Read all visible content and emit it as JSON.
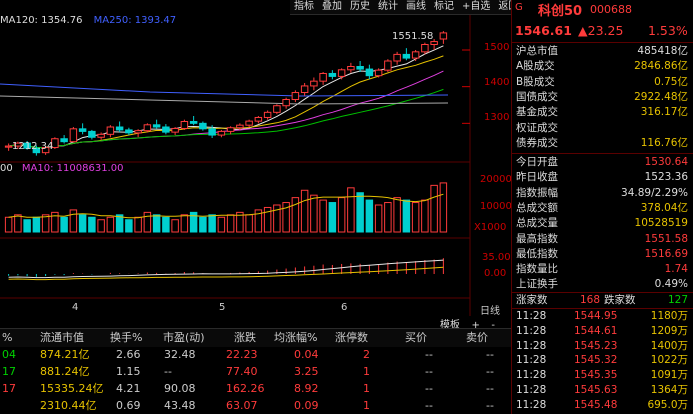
{
  "toolbar": [
    "指标",
    "叠加",
    "历史",
    "统计",
    "画线",
    "标记",
    "+自选",
    "返回"
  ],
  "ma_legend": {
    "ma120": "MA120: 1354.76",
    "ma250": "MA250: 1393.47"
  },
  "vol_legend": {
    "a": "00",
    "ma10": "MA10: 11008631.00"
  },
  "price_labels": {
    "high": "1551.58",
    "low": "1212.34"
  },
  "yaxis_price": [
    "1500",
    "1400",
    "1300"
  ],
  "yaxis_vol": [
    "20000",
    "10000",
    "X1000"
  ],
  "yaxis_ind": [
    "35.00",
    "0.00"
  ],
  "xaxis": [
    "4",
    "5",
    "6"
  ],
  "xaxis_unit": "日线",
  "tabs": [
    "模板",
    "+",
    "-"
  ],
  "right": {
    "g": "G",
    "name": "科创50",
    "code": "000688",
    "price": "1546.61",
    "change": "▲23.25",
    "pct": "1.53%",
    "rows": [
      {
        "k": "沪总市值",
        "v": "485418亿",
        "c": "white"
      },
      {
        "k": "A股成交",
        "v": "2846.86亿",
        "c": "yel"
      },
      {
        "k": "B股成交",
        "v": "0.75亿",
        "c": "yel"
      },
      {
        "k": "国债成交",
        "v": "2922.48亿",
        "c": "yel"
      },
      {
        "k": "基金成交",
        "v": "316.17亿",
        "c": "yel"
      },
      {
        "k": "权证成交",
        "v": "",
        "c": "yel"
      },
      {
        "k": "债券成交",
        "v": "116.76亿",
        "c": "yel"
      }
    ],
    "rows2": [
      {
        "k": "今日开盘",
        "v": "1530.64",
        "c": "red"
      },
      {
        "k": "昨日收盘",
        "v": "1523.36",
        "c": "white"
      },
      {
        "k": "指数振幅",
        "v": "34.89/2.29%",
        "c": "white"
      },
      {
        "k": "总成交额",
        "v": "378.04亿",
        "c": "yel"
      },
      {
        "k": "总成交量",
        "v": "10528519",
        "c": "yel"
      },
      {
        "k": "最高指数",
        "v": "1551.58",
        "c": "red"
      },
      {
        "k": "最低指数",
        "v": "1516.69",
        "c": "red"
      },
      {
        "k": "指数量比",
        "v": "1.74",
        "c": "red"
      },
      {
        "k": "上证换手",
        "v": "0.49%",
        "c": "white"
      }
    ],
    "updown": {
      "up_label": "涨家数",
      "up": "168",
      "down_label": "跌家数",
      "down": "127"
    },
    "ticks": [
      {
        "t": "11:28",
        "p": "1544.95",
        "v": "1180万"
      },
      {
        "t": "11:28",
        "p": "1544.61",
        "v": "1209万"
      },
      {
        "t": "11:28",
        "p": "1545.23",
        "v": "1400万"
      },
      {
        "t": "11:28",
        "p": "1545.32",
        "v": "1022万"
      },
      {
        "t": "11:28",
        "p": "1545.35",
        "v": "1091万"
      },
      {
        "t": "11:28",
        "p": "1545.63",
        "v": "1364万"
      },
      {
        "t": "11:28",
        "p": "1545.48",
        "v": "695.0万"
      }
    ]
  },
  "table": {
    "headers": [
      "%",
      "流通市值",
      "换手%",
      "市盈(动)",
      "涨跌",
      "均涨幅%",
      "涨停数",
      "买价",
      "卖价"
    ],
    "rows": [
      {
        "a": "04",
        "b": "874.21亿",
        "c": "2.66",
        "d": "32.48",
        "e": "22.23",
        "f": "0.04",
        "g": "2",
        "h": "--",
        "i": "--",
        "ac": "green"
      },
      {
        "a": "17",
        "b": "881.24亿",
        "c": "1.15",
        "d": "--",
        "e": "77.40",
        "f": "3.25",
        "g": "1",
        "h": "--",
        "i": "--",
        "ac": "green"
      },
      {
        "a": "17",
        "b": "15335.24亿",
        "c": "4.21",
        "d": "90.08",
        "e": "162.26",
        "f": "8.92",
        "g": "1",
        "h": "--",
        "i": "--",
        "ac": "red"
      },
      {
        "a": "",
        "b": "2310.44亿",
        "c": "0.69",
        "d": "43.48",
        "e": "63.07",
        "f": "0.09",
        "g": "1",
        "h": "--",
        "i": "--",
        "ac": "red"
      }
    ]
  },
  "chart_data": {
    "type": "candlestick",
    "candles": [
      [
        1235,
        1245,
        1225,
        1238
      ],
      [
        1238,
        1250,
        1230,
        1246
      ],
      [
        1246,
        1252,
        1228,
        1232
      ],
      [
        1232,
        1240,
        1212,
        1220
      ],
      [
        1220,
        1238,
        1214,
        1234
      ],
      [
        1234,
        1262,
        1230,
        1258
      ],
      [
        1258,
        1268,
        1245,
        1250
      ],
      [
        1250,
        1290,
        1248,
        1285
      ],
      [
        1285,
        1300,
        1270,
        1278
      ],
      [
        1278,
        1282,
        1256,
        1262
      ],
      [
        1262,
        1275,
        1255,
        1270
      ],
      [
        1270,
        1295,
        1262,
        1290
      ],
      [
        1290,
        1305,
        1276,
        1282
      ],
      [
        1282,
        1288,
        1268,
        1274
      ],
      [
        1274,
        1284,
        1262,
        1280
      ],
      [
        1280,
        1300,
        1275,
        1296
      ],
      [
        1296,
        1310,
        1285,
        1290
      ],
      [
        1290,
        1298,
        1270,
        1276
      ],
      [
        1276,
        1290,
        1268,
        1286
      ],
      [
        1286,
        1310,
        1282,
        1305
      ],
      [
        1305,
        1320,
        1295,
        1300
      ],
      [
        1300,
        1305,
        1280,
        1285
      ],
      [
        1285,
        1295,
        1260,
        1268
      ],
      [
        1268,
        1282,
        1262,
        1278
      ],
      [
        1278,
        1292,
        1270,
        1288
      ],
      [
        1288,
        1300,
        1282,
        1295
      ],
      [
        1295,
        1310,
        1290,
        1306
      ],
      [
        1306,
        1320,
        1300,
        1316
      ],
      [
        1316,
        1335,
        1310,
        1330
      ],
      [
        1330,
        1352,
        1325,
        1348
      ],
      [
        1348,
        1370,
        1340,
        1365
      ],
      [
        1365,
        1390,
        1358,
        1384
      ],
      [
        1384,
        1410,
        1375,
        1402
      ],
      [
        1402,
        1425,
        1390,
        1415
      ],
      [
        1415,
        1440,
        1405,
        1436
      ],
      [
        1436,
        1445,
        1420,
        1428
      ],
      [
        1428,
        1450,
        1420,
        1446
      ],
      [
        1446,
        1465,
        1438,
        1455
      ],
      [
        1455,
        1470,
        1440,
        1448
      ],
      [
        1448,
        1460,
        1420,
        1430
      ],
      [
        1430,
        1450,
        1425,
        1445
      ],
      [
        1445,
        1475,
        1440,
        1470
      ],
      [
        1470,
        1495,
        1460,
        1488
      ],
      [
        1488,
        1505,
        1472,
        1478
      ],
      [
        1478,
        1500,
        1470,
        1495
      ],
      [
        1495,
        1520,
        1488,
        1515
      ],
      [
        1515,
        1530,
        1500,
        1523
      ],
      [
        1530,
        1551.58,
        1516.69,
        1546.61
      ]
    ],
    "volumes": [
      6,
      7,
      5,
      6,
      7,
      8,
      6,
      9,
      7,
      6,
      5,
      6,
      7,
      5,
      6,
      8,
      7,
      6,
      5,
      7,
      8,
      6,
      7,
      6,
      7,
      8,
      7,
      9,
      10,
      11,
      12,
      14,
      17,
      15,
      13,
      12,
      14,
      18,
      16,
      13,
      11,
      12,
      14,
      13,
      12,
      13,
      19,
      20
    ],
    "ylim_price": [
      1200,
      1560
    ],
    "ylim_vol": [
      0,
      22000
    ]
  }
}
